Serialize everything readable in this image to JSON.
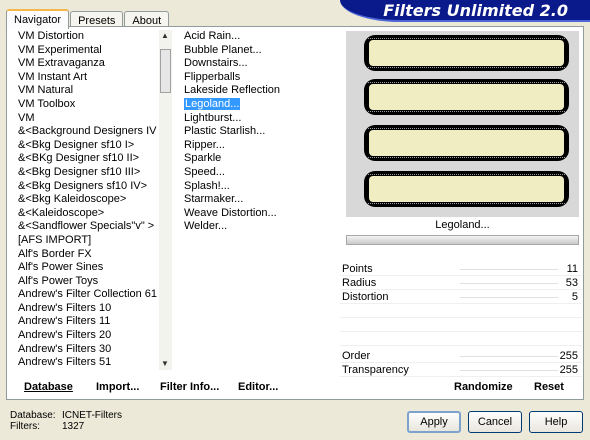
{
  "window": {
    "title": "Filters Unlimited 2.0"
  },
  "tabs": [
    {
      "label": "Navigator",
      "active": true
    },
    {
      "label": "Presets",
      "active": false
    },
    {
      "label": "About",
      "active": false
    }
  ],
  "categories": [
    "VM Distortion",
    "VM Experimental",
    "VM Extravaganza",
    "VM Instant Art",
    "VM Natural",
    "VM Toolbox",
    "VM",
    "&<Background Designers IV>",
    "&<Bkg Designer sf10 I>",
    "&<BKg Designer sf10 II>",
    "&<Bkg Designer sf10 III>",
    "&<Bkg Designers sf10 IV>",
    "&<Bkg Kaleidoscope>",
    "&<Kaleidoscope>",
    "&<Sandflower Specials\"v\" >",
    "[AFS IMPORT]",
    "Alf's Border FX",
    "Alf's Power Sines",
    "Alf's Power Toys",
    "Andrew's Filter Collection 61",
    "Andrew's Filters 10",
    "Andrew's Filters 11",
    "Andrew's Filters 20",
    "Andrew's Filters 30",
    "Andrew's Filters 51"
  ],
  "filters": [
    {
      "label": "Acid Rain...",
      "selected": false
    },
    {
      "label": "Bubble Planet...",
      "selected": false
    },
    {
      "label": "Downstairs...",
      "selected": false
    },
    {
      "label": "Flipperballs",
      "selected": false
    },
    {
      "label": "Lakeside Reflection",
      "selected": false
    },
    {
      "label": "Legoland...",
      "selected": true
    },
    {
      "label": "Lightburst...",
      "selected": false
    },
    {
      "label": "Plastic Starlish...",
      "selected": false
    },
    {
      "label": "Ripper...",
      "selected": false
    },
    {
      "label": "Sparkle",
      "selected": false
    },
    {
      "label": "Speed...",
      "selected": false
    },
    {
      "label": "Splash!...",
      "selected": false
    },
    {
      "label": "Starmaker...",
      "selected": false
    },
    {
      "label": "Weave Distortion...",
      "selected": false
    },
    {
      "label": "Welder...",
      "selected": false
    }
  ],
  "preview": {
    "filter_name": "Legoland...",
    "fill_color": "#f0edc2"
  },
  "parameters": [
    {
      "label": "Points",
      "value": "11"
    },
    {
      "label": "Radius",
      "value": "53"
    },
    {
      "label": "Distortion",
      "value": "5"
    }
  ],
  "blend": [
    {
      "label": "Order",
      "value": "255"
    },
    {
      "label": "Transparency",
      "value": "255"
    }
  ],
  "toolbar": {
    "database": "Database",
    "import": "Import...",
    "filter_info": "Filter Info...",
    "editor": "Editor...",
    "randomize": "Randomize",
    "reset": "Reset"
  },
  "footer": {
    "database_label": "Database:",
    "database_value": "ICNET-Filters",
    "filters_label": "Filters:",
    "filters_value": "1327"
  },
  "buttons": {
    "apply": "Apply",
    "cancel": "Cancel",
    "help": "Help"
  },
  "colors": {
    "accent": "#3399ff",
    "banner": "#0b1a8a"
  }
}
